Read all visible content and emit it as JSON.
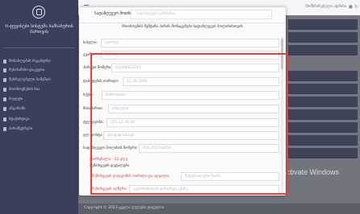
{
  "sidebar": {
    "brand": "ti-ფუყისები სისტემა სამსახურის მართვის",
    "items": [
      {
        "label": "მოსახლების რეგისტრი",
        "icon": "user-icon"
      },
      {
        "label": "შესაბამისი დაკვეთა",
        "icon": "document-icon"
      },
      {
        "label": "შესრულებული სამუშაო",
        "icon": "list-icon"
      },
      {
        "label": "მოთხოვნების სია",
        "icon": "people-icon"
      },
      {
        "label": "ბიუჯეტი",
        "icon": "money-icon"
      },
      {
        "label": "ანგარიში",
        "icon": "report-icon"
      },
      {
        "label": "სტატისტიკა",
        "icon": "chart-icon"
      },
      {
        "label": "პარამეტრები",
        "icon": "gear-icon"
      }
    ]
  },
  "topbar": {
    "user_label": "მომხმარებელი ადმინი",
    "bell_icon": "bell-icon",
    "logout_icon": "logout-icon",
    "menu_icon": "hamburger-icon"
  },
  "watermark": "Activate Windows",
  "footer": "Copyright © 2023 ყველა უფლება დაცულია",
  "modal": {
    "header_label": "სადაზღვევო მოთხოვნა",
    "header_value": "სადაზღვევო კომპანია",
    "subtitle": "მოთხოვნის შემტანი პირის მონაცემები სადაზღვევო პოლისისთვის",
    "fields": [
      {
        "label": "სახელი:",
        "value": "გიორგი"
      },
      {
        "label": "გვარი:",
        "value": "ბერიძე"
      },
      {
        "label": "პირადი ნომერი:",
        "value": "01008012345"
      },
      {
        "label": "დაბადების თარიღი:",
        "value": "12.05.1985"
      },
      {
        "label": "სქესი:",
        "value": "მამრობითი"
      },
      {
        "label": "მისამართი:",
        "value": "თბილისი"
      },
      {
        "label": "ტელეფონი:",
        "value": "555 12 34 56"
      },
      {
        "label": "ელ.ფოსტა:",
        "value": "giorgi@mail.ge"
      },
      {
        "label": "სადაზღვევო პოლისის ნომერი:",
        "value": "POL-2023-0456"
      }
    ],
    "note_red": "დარჩენილი - 12 დღე",
    "note_plain": "შემთხვევის დეტალები",
    "extra_fields": [
      {
        "label": "შემთხვევის დადგომის თარიღი და ადგილი:",
        "value": "მატერიალური ზიანი"
      },
      {
        "label": "შემთხვევის აღწერა:",
        "value": "ავტომობილის დაზიანება გზაზე"
      }
    ]
  },
  "colors": {
    "sidebar_bg": "#3b3f5c",
    "highlight": "#e8403c",
    "badge": "#b9962d"
  }
}
